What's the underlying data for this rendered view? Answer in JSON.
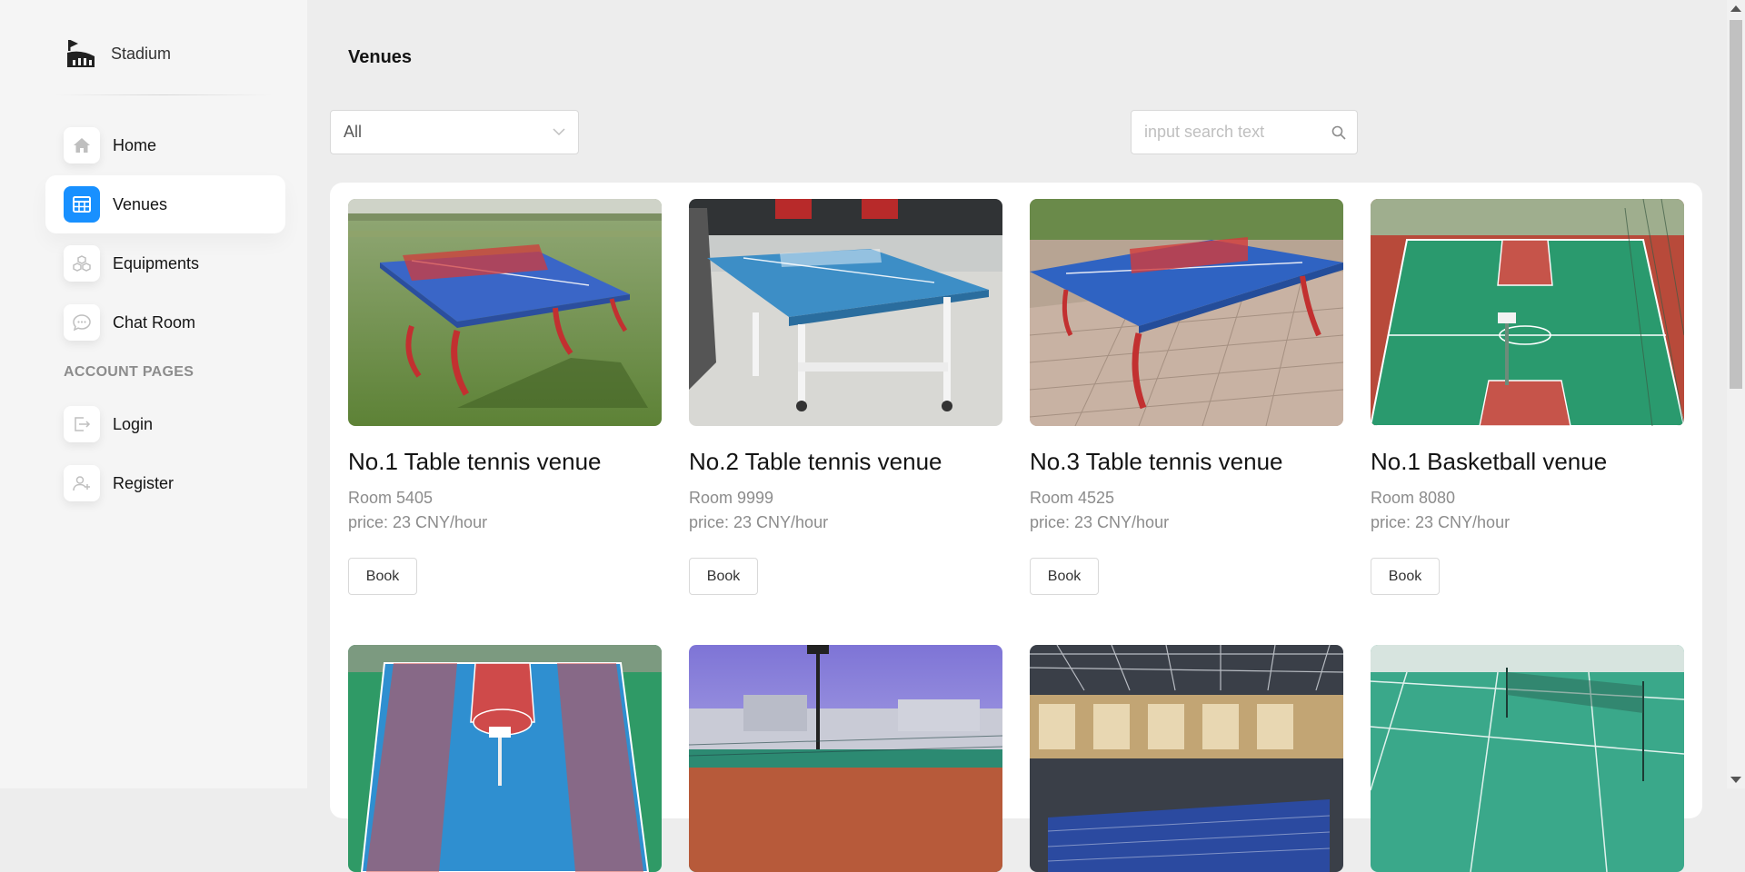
{
  "brand": {
    "name": "Stadium",
    "logo_icon": "stadium-logo-icon"
  },
  "sidebar": {
    "items": [
      {
        "label": "Home",
        "icon": "home-icon",
        "active": false
      },
      {
        "label": "Venues",
        "icon": "table-grid-icon",
        "active": true
      },
      {
        "label": "Equipments",
        "icon": "equipments-icon",
        "active": false
      },
      {
        "label": "Chat Room",
        "icon": "chat-icon",
        "active": false
      }
    ],
    "section_title": "ACCOUNT PAGES",
    "account_items": [
      {
        "label": "Login",
        "icon": "login-icon"
      },
      {
        "label": "Register",
        "icon": "register-icon"
      }
    ]
  },
  "page": {
    "title": "Venues"
  },
  "filter": {
    "selected": "All"
  },
  "search": {
    "placeholder": "input search text"
  },
  "venues": [
    {
      "title": "No.1 Table tennis venue",
      "room": "Room 5405",
      "price": "price: 23 CNY/hour",
      "button": "Book"
    },
    {
      "title": "No.2 Table tennis venue",
      "room": "Room 9999",
      "price": "price: 23 CNY/hour",
      "button": "Book"
    },
    {
      "title": "No.3 Table tennis venue",
      "room": "Room 4525",
      "price": "price: 23 CNY/hour",
      "button": "Book"
    },
    {
      "title": "No.1 Basketball venue",
      "room": "Room 8080",
      "price": "price: 23 CNY/hour",
      "button": "Book"
    }
  ],
  "colors": {
    "accent": "#1890ff",
    "background": "#ededed",
    "sidebar": "#f5f5f5"
  }
}
